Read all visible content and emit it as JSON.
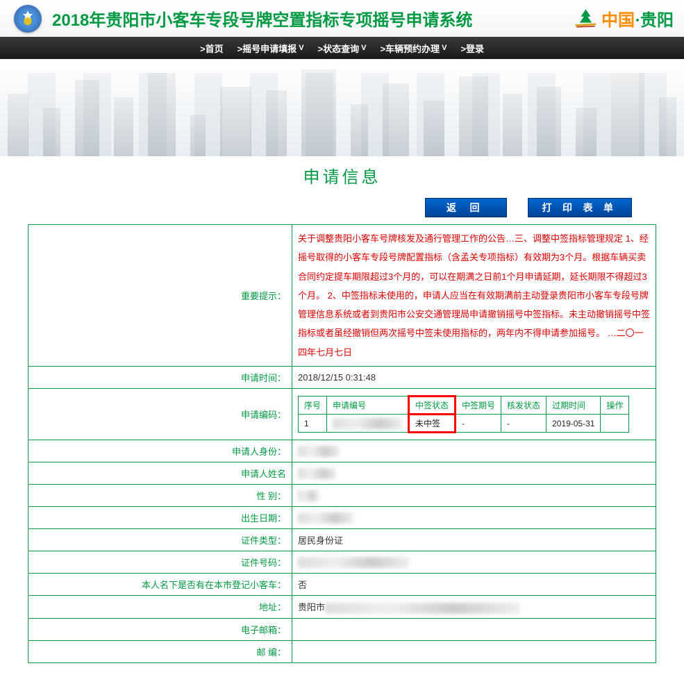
{
  "header": {
    "title": "2018年贵阳市小客车专段号牌空置指标专项摇号申请系统",
    "brand_china": "中国",
    "brand_dot": "·",
    "brand_city": "贵阳"
  },
  "nav": {
    "home": ">首页",
    "apply": ">摇号申请填报",
    "status": ">状态查询",
    "vehicle": ">车辆预约办理",
    "login": ">登录",
    "dropdown": "V"
  },
  "section": {
    "title": "申请信息",
    "btn_back": "返 回",
    "btn_print": "打 印 表 单"
  },
  "labels": {
    "notice": "重要提示：",
    "apply_time": "申请时间：",
    "apply_code": "申请编码：",
    "identity": "申请人身份：",
    "name": "申请人姓名",
    "gender": "性 别：",
    "birth": "出生日期：",
    "id_type": "证件类型：",
    "id_no": "证件号码：",
    "has_car": "本人名下是否有在本市登记小客车：",
    "address": "地址：",
    "email": "电子邮箱：",
    "postcode": "邮 编："
  },
  "notice_text": "关于调整贵阳小客车号牌核发及通行管理工作的公告…三、调整中签指标管理规定 1、经摇号取得的小客车专段号牌配置指标（含孟关专项指标）有效期为3个月。根据车辆买卖合同约定提车期限超过3个月的，可以在期满之日前1个月申请延期，延长期限不得超过3个月。 2、中签指标未使用的，申请人应当在有效期满前主动登录贵阳市小客车专段号牌管理信息系统或者到贵阳市公安交通管理局申请撤销摇号中签指标。未主动撤销摇号中签指标或者虽经撤销但两次摇号中签未使用指标的，两年内不得申请参加摇号。 …二〇一四年七月七日",
  "values": {
    "apply_time": "2018/12/15 0:31:48",
    "id_type": "居民身份证",
    "has_car": "否",
    "address_prefix": "贵阳市"
  },
  "inner_table": {
    "headers": {
      "seq": "序号",
      "code": "申请编号",
      "status": "中签状态",
      "period": "中签期号",
      "issue": "核发状态",
      "expire": "过期时间",
      "op": "操作"
    },
    "row": {
      "seq": "1",
      "code": "",
      "status": "未中签",
      "period": "-",
      "issue": "-",
      "expire": "2019-05-31",
      "op": ""
    }
  }
}
